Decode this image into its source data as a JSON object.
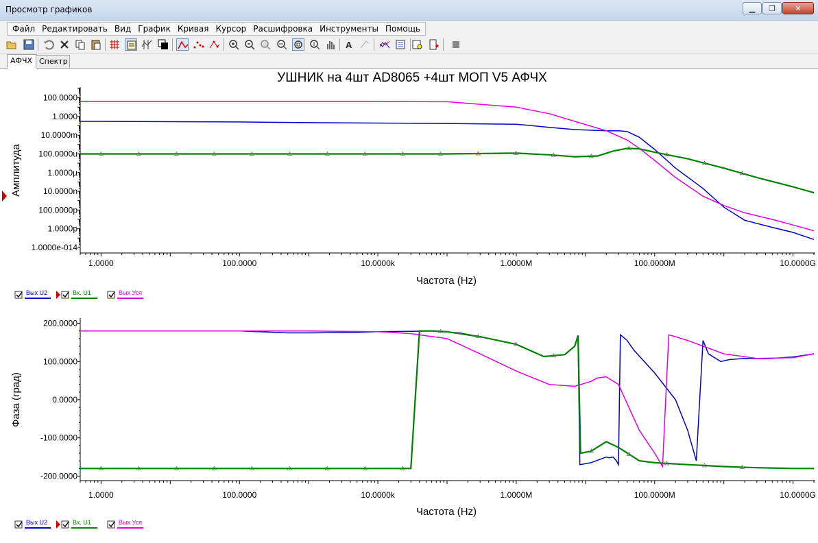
{
  "window": {
    "title": "Просмотр графиков"
  },
  "menu": [
    "Файл",
    "Редактировать",
    "Вид",
    "График",
    "Кривая",
    "Курсор",
    "Расшифровка",
    "Инструменты",
    "Помощь"
  ],
  "toolbar": [
    "open-icon",
    "save-icon",
    "undo-icon",
    "delete-icon",
    "copy-icon",
    "paste-icon",
    "grid-icon",
    "legend-icon",
    "cursors-icon",
    "background-icon",
    "line-mode-icon",
    "points-mode-icon",
    "line-points-icon",
    "zoom-in-icon",
    "zoom-out-icon",
    "zoom-full-icon",
    "zoom-x-icon",
    "zoom-box-icon",
    "zoom-y-icon",
    "pan-icon",
    "text-icon",
    "marker-icon",
    "overlay-icon",
    "export-icon",
    "print-preview-icon",
    "print-icon",
    "stop-icon"
  ],
  "tabs": [
    "АФЧХ",
    "Спектр"
  ],
  "colors": {
    "u2": "#0000c8",
    "u1": "#008000",
    "usil": "#e000e0",
    "axis": "#000000"
  },
  "chart_data": [
    {
      "type": "line",
      "title": "УШНИК на 4шт AD8065 +4шт МОП V5 АФЧХ",
      "xlabel": "Частота (Hz)",
      "ylabel": "Амплитуда",
      "xscale": "log",
      "yscale": "log",
      "xlim": [
        0.5,
        20000000000
      ],
      "ylim": [
        3e-15,
        1000
      ],
      "xticks": [
        "1.0000",
        "100.0000",
        "10.0000k",
        "1.0000M",
        "100.0000M",
        "10.0000G"
      ],
      "yticks": [
        "100.0000",
        "1.0000",
        "10.0000m",
        "100.0000u",
        "1.0000µ",
        "10.0000n",
        "100.0000p",
        "1.0000p",
        "1.0000e-014"
      ],
      "legend_placement": "bottom-left",
      "series": [
        {
          "name": "Вых U2",
          "x": [
            0.5,
            1,
            10,
            100,
            1000,
            10000,
            100000,
            1000000,
            3000000,
            7000000,
            20000000,
            30000000,
            40000000,
            60000000,
            100000000,
            200000000,
            500000000,
            1000000000,
            2000000000,
            5000000000,
            10000000000,
            20000000000
          ],
          "y": [
            0.3,
            0.3,
            0.28,
            0.26,
            0.22,
            0.2,
            0.18,
            0.15,
            0.07,
            0.04,
            0.03,
            0.03,
            0.025,
            0.006,
            0.0003,
            3e-06,
            2e-08,
            2e-10,
            8e-12,
            1.4e-12,
            4e-13,
            7e-14
          ]
        },
        {
          "name": "Вх. U1",
          "x": [
            0.5,
            1,
            10,
            100,
            1000,
            10000,
            100000,
            1000000,
            3000000,
            7000000,
            15000000,
            25000000,
            40000000,
            60000000,
            100000000,
            300000000,
            1000000000,
            3000000000,
            10000000000,
            20000000000
          ],
          "y": [
            0.0001,
            0.0001,
            0.0001,
            0.0001,
            0.0001,
            0.0001,
            0.0001,
            0.00012,
            8e-05,
            5e-05,
            6e-05,
            0.0002,
            0.0004,
            0.00035,
            0.00015,
            3e-05,
            3e-06,
            3e-07,
            3e-08,
            7e-09
          ]
        },
        {
          "name": "Вых Уся",
          "x": [
            0.5,
            1,
            10,
            100,
            1000,
            10000,
            100000,
            1000000,
            3000000,
            7000000,
            20000000,
            40000000,
            60000000,
            100000000,
            200000000,
            500000000,
            1000000000,
            2000000000,
            5000000000,
            10000000000,
            20000000000
          ],
          "y": [
            40,
            40,
            40,
            40,
            40,
            40,
            38,
            10,
            2,
            0.3,
            0.03,
            0.003,
            0.0004,
            2e-05,
            3e-07,
            3e-09,
            3e-10,
            5e-11,
            1e-11,
            2.5e-12,
            6e-13
          ]
        }
      ]
    },
    {
      "type": "line",
      "title": "",
      "xlabel": "Частота (Hz)",
      "ylabel": "Фаза (град)",
      "xscale": "log",
      "xlim": [
        0.5,
        20000000000
      ],
      "ylim": [
        -210,
        210
      ],
      "xticks": [
        "1.0000",
        "100.0000",
        "10.0000k",
        "1.0000M",
        "100.0000M",
        "10.0000G"
      ],
      "yticks": [
        "200.0000",
        "100.0000",
        "0.0000",
        "-100.0000",
        "-200.0000"
      ],
      "legend_placement": "bottom-left",
      "series": [
        {
          "name": "Вых U2",
          "x": [
            0.5,
            100,
            500,
            1000,
            5000,
            10000,
            30000,
            60000,
            150000,
            300000,
            1000000,
            2500000,
            5000000,
            7000000,
            7800000,
            8300000,
            12000000,
            20000000,
            22000000,
            25000000,
            28000000,
            30000000,
            32000000,
            40000000,
            50000000,
            100000000,
            200000000,
            300000000,
            400000000,
            500000000,
            600000000,
            900000000,
            1200000000,
            2000000000,
            4000000000,
            10000000000,
            20000000000
          ],
          "y": [
            180,
            180,
            175,
            175,
            176,
            178,
            179,
            180,
            175,
            165,
            145,
            113,
            118,
            140,
            168,
            -170,
            -165,
            -150,
            -152,
            -150,
            -160,
            -170,
            170,
            155,
            130,
            70,
            0,
            -80,
            -160,
            155,
            120,
            100,
            105,
            108,
            107,
            112,
            120
          ]
        },
        {
          "name": "Вх. U1",
          "x": [
            0.5,
            1000,
            10000,
            20000,
            30000,
            40000,
            60000,
            100000,
            300000,
            1000000,
            2500000,
            5000000,
            7000000,
            7800000,
            8500000,
            12000000,
            20000000,
            30000000,
            60000000,
            100000000,
            300000000,
            1000000000,
            3000000000,
            10000000000,
            20000000000
          ],
          "y": [
            -180,
            -180,
            -180,
            -180,
            -180,
            180,
            180,
            178,
            165,
            145,
            113,
            118,
            140,
            168,
            -140,
            -135,
            -110,
            -125,
            -160,
            -165,
            -170,
            -175,
            -178,
            -180,
            -180
          ]
        },
        {
          "name": "Вых Уся",
          "x": [
            0.5,
            10,
            100,
            1000,
            10000,
            30000,
            100000,
            300000,
            1000000,
            3000000,
            7000000,
            12000000,
            15000000,
            20000000,
            30000000,
            40000000,
            60000000,
            100000000,
            130000000,
            140000000,
            160000000,
            200000000,
            300000000,
            1000000000,
            3000000000,
            10000000000,
            20000000000
          ],
          "y": [
            180,
            180,
            180,
            180,
            178,
            173,
            160,
            120,
            75,
            40,
            35,
            48,
            57,
            60,
            40,
            -10,
            -80,
            -140,
            -175,
            -50,
            170,
            165,
            155,
            120,
            108,
            110,
            120
          ]
        }
      ]
    }
  ]
}
